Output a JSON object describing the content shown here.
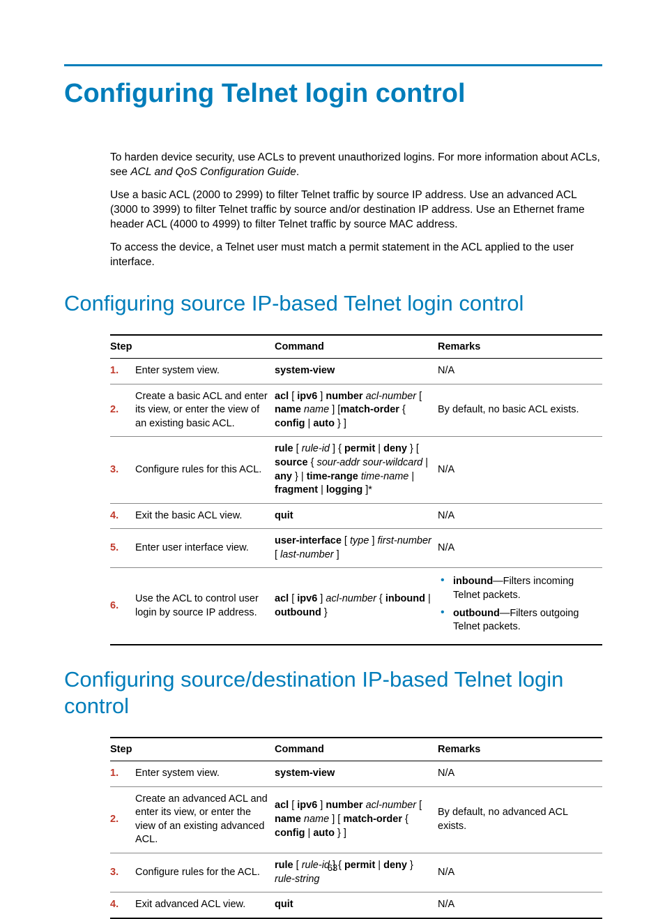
{
  "page_number": "63",
  "title": "Configuring Telnet login control",
  "intro": {
    "p1a": "To harden device security, use ACLs to prevent unauthorized logins. For more information about ACLs, see ",
    "p1b_ital": "ACL and QoS Configuration Guide",
    "p1c": ".",
    "p2": "Use a basic ACL (2000 to 2999) to filter Telnet traffic by source IP address. Use an advanced ACL (3000 to 3999) to filter Telnet traffic by source and/or destination IP address. Use an Ethernet frame header ACL (4000 to 4999) to filter Telnet traffic by source MAC address.",
    "p3": "To access the device, a Telnet user must match a permit statement in the ACL applied to the user interface."
  },
  "section1": {
    "heading": "Configuring source IP-based Telnet login control",
    "headers": {
      "step": "Step",
      "command": "Command",
      "remarks": "Remarks"
    },
    "rows": [
      {
        "n": "1.",
        "step": "Enter system view.",
        "cmd_html": "<b>system-view</b>",
        "remarks_html": "N/A"
      },
      {
        "n": "2.",
        "step": "Create a basic ACL and enter its view, or enter the view of an existing basic ACL.",
        "cmd_html": "<b>acl</b> [ <b>ipv6</b> ] <b>number</b> <i>acl-number</i> [ <b>name</b> <i>name</i> ] [<b>match-order</b> { <b>config</b> | <b>auto</b> } ]",
        "remarks_html": "By default, no basic ACL exists."
      },
      {
        "n": "3.",
        "step": "Configure rules for this ACL.",
        "cmd_html": "<b>rule</b> [ <i>rule-id</i> ] { <b>permit</b> | <b>deny</b> } [ <b>source</b> { <i>sour-addr sour-wildcard</i> | <b>any</b> } | <b>time-range</b> <i>time-name</i> | <b>fragment</b> | <b>logging</b> ]*",
        "remarks_html": "N/A"
      },
      {
        "n": "4.",
        "step": "Exit the basic ACL view.",
        "cmd_html": "<b>quit</b>",
        "remarks_html": "N/A"
      },
      {
        "n": "5.",
        "step": "Enter user interface view.",
        "cmd_html": "<b>user-interface</b> [ <i>type</i> ] <i>first-number</i> [ <i>last-number</i> ]",
        "remarks_html": "N/A"
      },
      {
        "n": "6.",
        "step": "Use the ACL to control user login by source IP address.",
        "cmd_html": "<b>acl</b> [ <b>ipv6</b> ] <i>acl-number</i> { <b>inbound</b> | <b>outbound</b> }",
        "remarks_html": "<ul class=\"bullets\"><li><b>inbound</b>—Filters incoming Telnet packets.</li><li><b>outbound</b>—Filters outgoing Telnet packets.</li></ul>"
      }
    ]
  },
  "section2": {
    "heading": "Configuring source/destination IP-based Telnet login control",
    "headers": {
      "step": "Step",
      "command": "Command",
      "remarks": "Remarks"
    },
    "rows": [
      {
        "n": "1.",
        "step": "Enter system view.",
        "cmd_html": "<b>system-view</b>",
        "remarks_html": "N/A"
      },
      {
        "n": "2.",
        "step": "Create an advanced ACL and enter its view, or enter the view of an existing advanced ACL.",
        "cmd_html": "<b>acl</b> [ <b>ipv6</b> ] <b>number</b> <i>acl-number</i> [ <b>name</b> <i>name</i> ] [ <b>match-order</b> { <b>config</b> | <b>auto</b> } ]",
        "remarks_html": "By default, no advanced ACL exists."
      },
      {
        "n": "3.",
        "step": "Configure rules for the ACL.",
        "cmd_html": "<b>rule</b> [ <i>rule-id</i> ] { <b>permit</b> | <b>deny</b> } <i>rule-string</i>",
        "remarks_html": "N/A"
      },
      {
        "n": "4.",
        "step": "Exit advanced ACL view.",
        "cmd_html": "<b>quit</b>",
        "remarks_html": "N/A"
      }
    ]
  }
}
